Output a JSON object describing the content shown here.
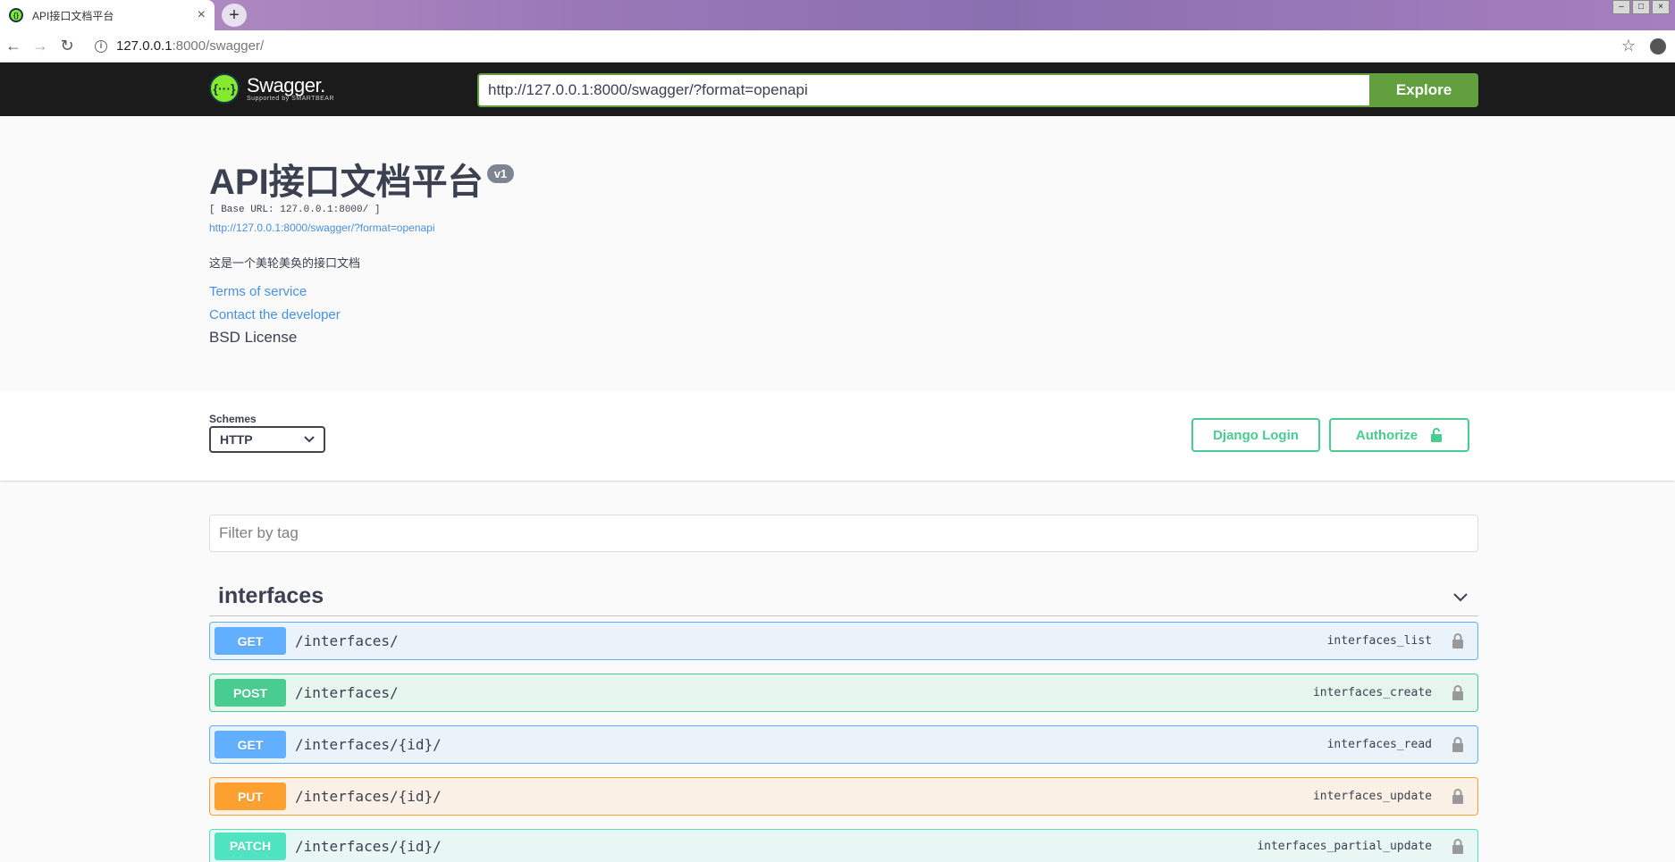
{
  "browser": {
    "tab_title": "API接口文档平台",
    "tab_close": "×",
    "new_tab": "+",
    "url_host": "127.0.0.1",
    "url_rest": ":8000/swagger/"
  },
  "topbar": {
    "logo_name": "Swagger.",
    "logo_sub": "Supported by SMARTBEAR",
    "spec_url_value": "http://127.0.0.1:8000/swagger/?format=openapi",
    "explore_label": "Explore"
  },
  "info": {
    "title": "API接口文档平台",
    "version": "v1",
    "base_url": "[ Base URL: 127.0.0.1:8000/ ]",
    "spec_link": "http://127.0.0.1:8000/swagger/?format=openapi",
    "description": "这是一个美轮美奂的接口文档",
    "terms": "Terms of service",
    "contact": "Contact the developer",
    "license": "BSD License"
  },
  "schemes": {
    "label": "Schemes",
    "selected": "HTTP"
  },
  "auth": {
    "django_login": "Django Login",
    "authorize": "Authorize"
  },
  "filter": {
    "placeholder": "Filter by tag"
  },
  "tag": {
    "name": "interfaces"
  },
  "operations": [
    {
      "method": "GET",
      "path": "/interfaces/",
      "operation_id": "interfaces_list"
    },
    {
      "method": "POST",
      "path": "/interfaces/",
      "operation_id": "interfaces_create"
    },
    {
      "method": "GET",
      "path": "/interfaces/{id}/",
      "operation_id": "interfaces_read"
    },
    {
      "method": "PUT",
      "path": "/interfaces/{id}/",
      "operation_id": "interfaces_update"
    },
    {
      "method": "PATCH",
      "path": "/interfaces/{id}/",
      "operation_id": "interfaces_partial_update"
    }
  ],
  "colors": {
    "get": "#61affe",
    "post": "#49cc90",
    "put": "#fca130",
    "patch": "#50e3c2",
    "explore": "#62a03f"
  }
}
